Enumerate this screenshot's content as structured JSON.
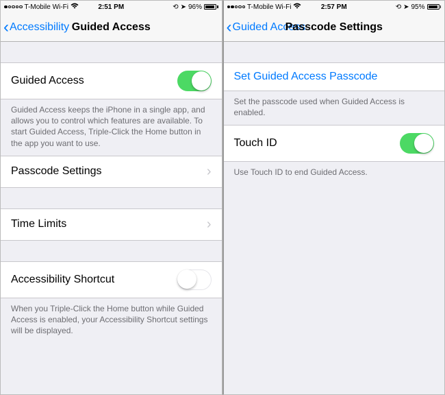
{
  "left": {
    "status": {
      "carrier": "T-Mobile Wi-Fi",
      "time": "2:51 PM",
      "battery_pct": "96%",
      "signal_filled": 1
    },
    "nav": {
      "back": "Accessibility",
      "title": "Guided Access"
    },
    "rows": {
      "guided_access": {
        "label": "Guided Access",
        "on": true
      },
      "guided_access_footer": "Guided Access keeps the iPhone in a single app, and allows you to control which features are available. To start Guided Access, Triple-Click the Home button in the app you want to use.",
      "passcode": {
        "label": "Passcode Settings"
      },
      "time_limits": {
        "label": "Time Limits"
      },
      "shortcut": {
        "label": "Accessibility Shortcut",
        "on": false
      },
      "shortcut_footer": "When you Triple-Click the Home button while Guided Access is enabled, your Accessibility Shortcut settings will be displayed."
    }
  },
  "right": {
    "status": {
      "carrier": "T-Mobile Wi-Fi",
      "time": "2:57 PM",
      "battery_pct": "95%",
      "signal_filled": 2
    },
    "nav": {
      "back": "Guided Access",
      "title": "Passcode Settings"
    },
    "rows": {
      "set_passcode": {
        "label": "Set Guided Access Passcode"
      },
      "set_passcode_footer": "Set the passcode used when Guided Access is enabled.",
      "touch_id": {
        "label": "Touch ID",
        "on": true
      },
      "touch_id_footer": "Use Touch ID to end Guided Access."
    }
  }
}
